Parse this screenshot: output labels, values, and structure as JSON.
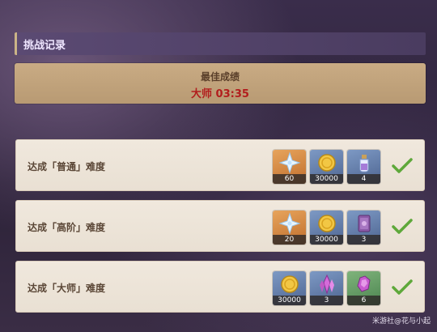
{
  "header": {
    "title": "挑战记录"
  },
  "best": {
    "title": "最佳成绩",
    "result": "大师 03:35"
  },
  "rows": [
    {
      "label": "达成「普通」难度",
      "rewards": [
        {
          "icon": "primogem-icon",
          "count": "60"
        },
        {
          "icon": "mora-coin-icon",
          "count": "30000"
        },
        {
          "icon": "potion-icon",
          "count": "4"
        }
      ]
    },
    {
      "label": "达成「高阶」难度",
      "rewards": [
        {
          "icon": "primogem-icon",
          "count": "20"
        },
        {
          "icon": "mora-coin-icon",
          "count": "30000"
        },
        {
          "icon": "purple-book-icon",
          "count": "3"
        }
      ]
    },
    {
      "label": "达成「大师」难度",
      "rewards": [
        {
          "icon": "mora-coin-icon",
          "count": "30000"
        },
        {
          "icon": "purple-crystal-icon",
          "count": "3"
        },
        {
          "icon": "crystal-chunk-icon",
          "count": "6"
        }
      ]
    }
  ],
  "watermark": "米游社@花与小起",
  "colors": {
    "accent_gold": "#cbb487",
    "best_text": "#b21d1d",
    "check_green": "#5ea83a"
  }
}
